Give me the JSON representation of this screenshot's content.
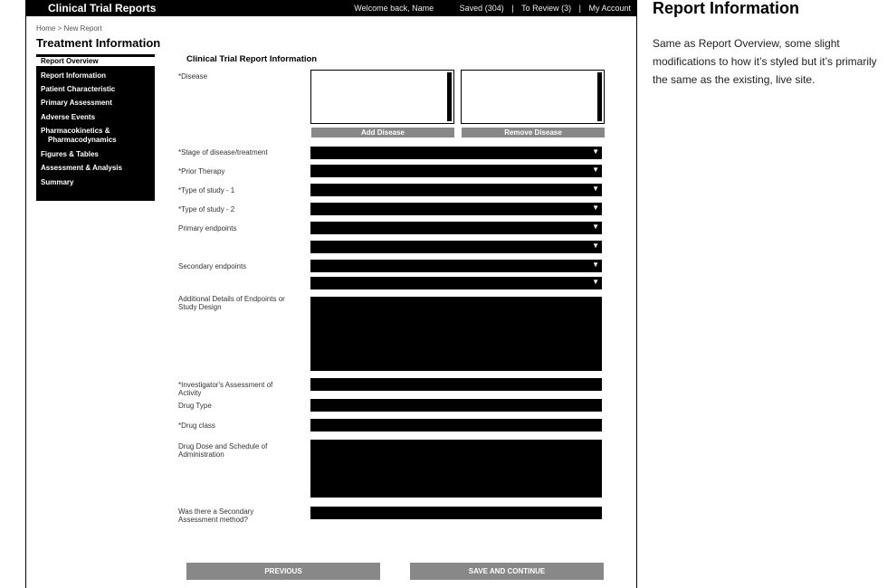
{
  "app": {
    "brand": "Clinical Trial Reports"
  },
  "topnav": {
    "welcome": "Welcome back, Name",
    "saved": "Saved (304)",
    "review": "To Review (3)",
    "account": "My Account"
  },
  "breadcrumb": "Home > New Report",
  "page_title": "Treatment Information",
  "sidebar": {
    "items": [
      {
        "label": "Report Overview"
      },
      {
        "label": "Report Information"
      },
      {
        "label": "Patient Characteristic"
      },
      {
        "label": "Primary Assessment"
      },
      {
        "label": "Adverse Events"
      },
      {
        "label": "Pharmacokinetics &"
      },
      {
        "label": "Pharmacodynamics"
      },
      {
        "label": "Figures & Tables"
      },
      {
        "label": "Assessment & Analysis"
      },
      {
        "label": "Summary"
      }
    ]
  },
  "form": {
    "title": "Clinical Trial Report Information",
    "disease_label": "*Disease",
    "add_disease": "Add Disease",
    "remove_disease": "Remove Disease",
    "stage_label": "*Stage of disease/treatment",
    "prior_label": "*Prior Therapy",
    "type1_label": "*Type of study - 1",
    "type2_label": "*Type of study - 2",
    "primary_label": "Primary endpoints",
    "secondary_label": "Secondary endpoints",
    "additional_label": "Additional Details of Endpoints or Study Design",
    "investigator_label": "*Investigator's Assessment of Activity",
    "drugtype_label": "Drug Type",
    "drugclass_label": "*Drug class",
    "dose_label": "Drug Dose and Schedule of Administration",
    "secondary_assess_label": "Was there a Secondary Assessment method?",
    "previous_button": "PREVIOUS",
    "save_button": "SAVE AND CONTINUE"
  },
  "panel": {
    "title": "Report Information",
    "description": "Same as Report Overview, some slight modifications to how it’s styled but it’s primarily the same as the existing, live site."
  }
}
